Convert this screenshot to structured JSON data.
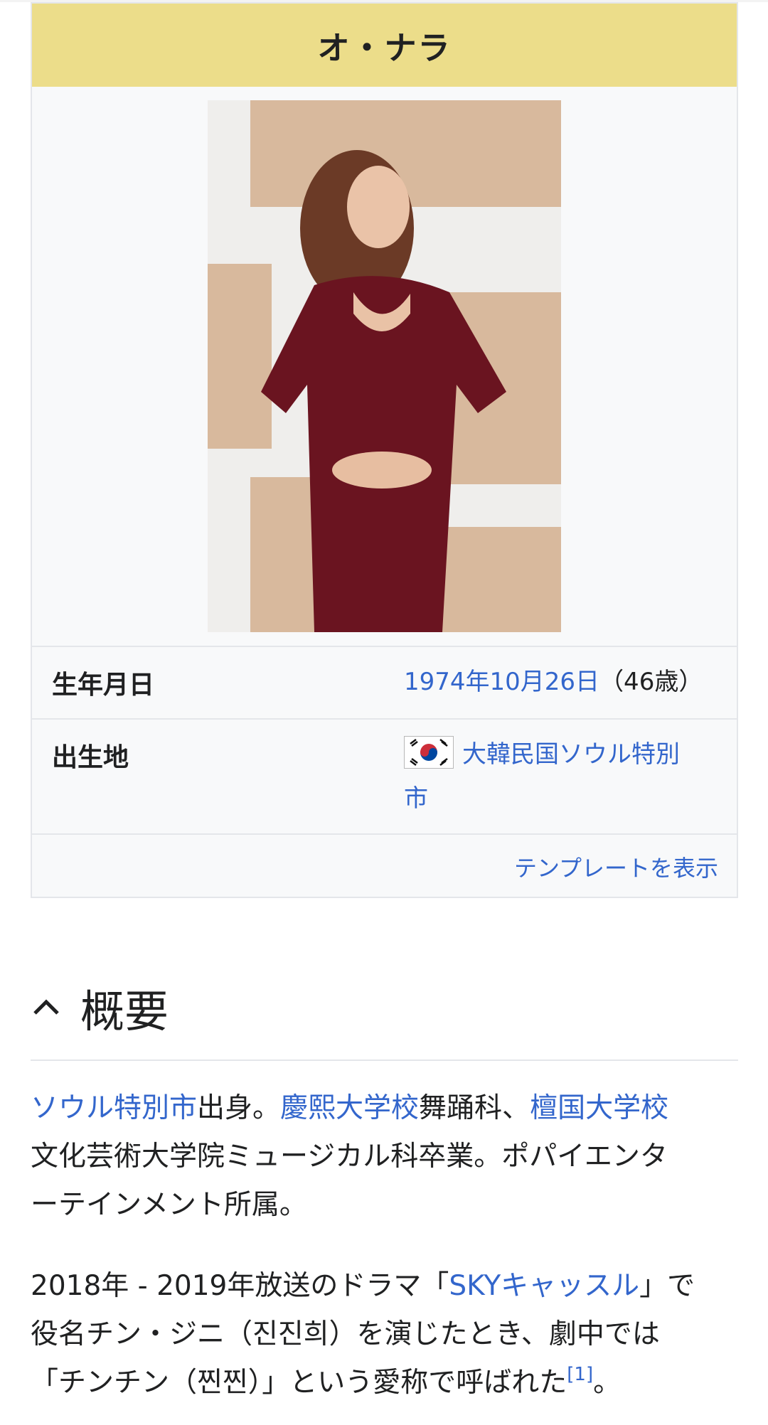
{
  "infobox": {
    "title": "オ・ナラ",
    "photo_alt": "portrait photo",
    "rows": [
      {
        "label": "生年月日",
        "date_link": "1974年10月26日",
        "age": "（46歳）"
      },
      {
        "label": "出生地",
        "flag_icon": "south-korea-flag",
        "place_link_line1": "大韓民国ソウル特別",
        "place_link_line2": "市"
      }
    ],
    "show_template": "テンプレートを表示"
  },
  "section": {
    "title": "概要",
    "toggle_icon": "chevron-up-icon"
  },
  "paragraphs": {
    "p1": {
      "link1": "ソウル特別市",
      "text1": "出身。",
      "link2": "慶熙大学校",
      "text2": "舞踊科、",
      "link3": "檀国大学校",
      "line2": "文化芸術大学院ミュージカル科卒業。ポパイエンタ",
      "line3": "ーテインメント所属。"
    },
    "p2": {
      "text1": "2018年 - 2019年放送のドラマ「",
      "link1": "SKYキャッスル",
      "text2": "」で",
      "line2": "役名チン・ジニ（진진희）を演じたとき、劇中では",
      "line3": "「チンチン（찐찐）」という愛称で呼ばれた",
      "ref": "[1]",
      "end": "。"
    }
  },
  "colors": {
    "link": "#3366cc",
    "title_bg": "#ecdd8a",
    "infobox_bg": "#f8f9fa"
  }
}
